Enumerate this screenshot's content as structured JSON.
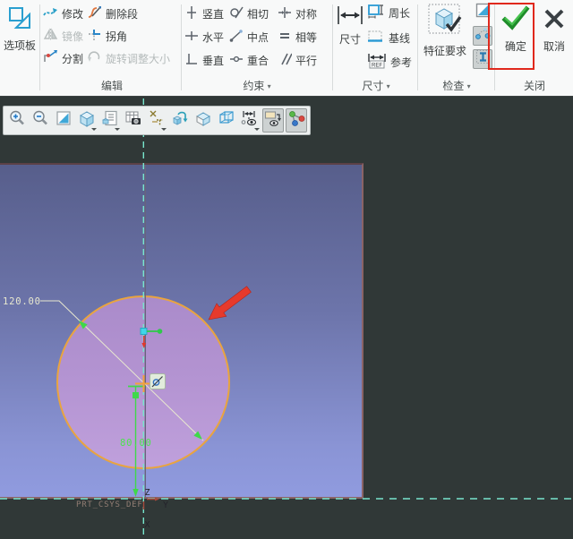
{
  "ribbon": {
    "palette": {
      "label": "选项板"
    },
    "edit": {
      "label": "编辑",
      "items": [
        {
          "label": "修改"
        },
        {
          "label": "删除段"
        },
        {
          "label": "镜像",
          "disabled": true
        },
        {
          "label": "拐角"
        },
        {
          "label": "分割"
        },
        {
          "label": "旋转调整大小",
          "disabled": true
        }
      ]
    },
    "constraints": {
      "label": "约束",
      "caret": "▾",
      "items": [
        {
          "label": "竖直"
        },
        {
          "label": "相切"
        },
        {
          "label": "对称"
        },
        {
          "label": "水平"
        },
        {
          "label": "中点"
        },
        {
          "label": "相等"
        },
        {
          "label": "垂直"
        },
        {
          "label": "重合"
        },
        {
          "label": "平行"
        }
      ]
    },
    "dimension": {
      "label": "尺寸",
      "caret": "▾",
      "primary": {
        "label": "尺寸"
      },
      "items": [
        {
          "label": "周长"
        },
        {
          "label": "基线"
        },
        {
          "label": "参考",
          "icon_text": "REF"
        }
      ]
    },
    "inspect": {
      "label": "检查",
      "caret": "▾",
      "primary": {
        "label": "特征要求"
      }
    },
    "close": {
      "label": "关闭",
      "ok": {
        "label": "确定"
      },
      "cancel": {
        "label": "取消"
      }
    }
  },
  "toolbar": {
    "buttons": [
      "zoom-in",
      "zoom-out",
      "refit",
      "saved-views",
      "view-list",
      "screen-capture",
      "datum-display",
      "reorient",
      "display-style",
      "perspective",
      "annotation-display",
      "sketch-display-toggle",
      "sketch-view-toggle"
    ]
  },
  "canvas": {
    "dimensions": {
      "diameter": "120.00",
      "distance": "80.00"
    },
    "csys_label": "PRT_CSYS_DEF",
    "axes": {
      "z": "Z",
      "y": "Y",
      "x": "X"
    },
    "colors": {
      "highlight_red": "#e0281c",
      "geometry_orange": "#e9a43f",
      "dim_green": "#3fd84a",
      "dim_white": "#e8e8cf",
      "reference_cyan": "#78e6cd",
      "plane_top": "#575e8b",
      "plane_bottom": "#909bdf"
    }
  }
}
